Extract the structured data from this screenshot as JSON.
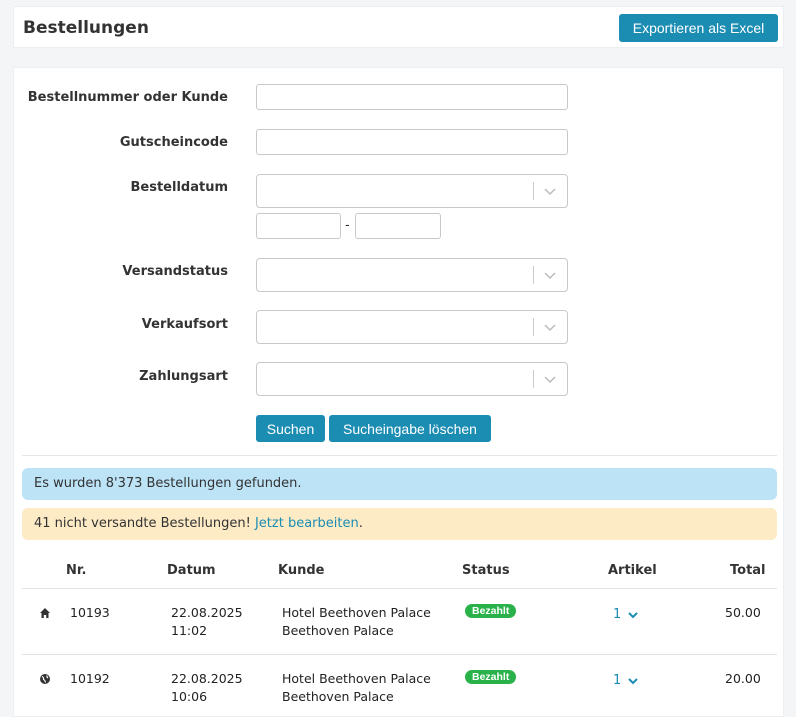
{
  "header": {
    "title": "Bestellungen",
    "export_label": "Exportieren als Excel"
  },
  "filters": {
    "order_label": "Bestellnummer oder Kunde",
    "coupon_label": "Gutscheincode",
    "date_label": "Bestelldatum",
    "date_separator": "-",
    "shipping_label": "Versandstatus",
    "salesplace_label": "Verkaufsort",
    "payment_label": "Zahlungsart",
    "search_label": "Suchen",
    "clear_label": "Sucheingabe löschen"
  },
  "alerts": {
    "found_text": "Es wurden 8'373 Bestellungen gefunden.",
    "unshipped_text": "41 nicht versandte Bestellungen! ",
    "unshipped_link": "Jetzt bearbeiten",
    "unshipped_suffix": "."
  },
  "table": {
    "headers": {
      "nr": "Nr.",
      "date": "Datum",
      "customer": "Kunde",
      "status": "Status",
      "articles": "Artikel",
      "total": "Total"
    },
    "rows": [
      {
        "icon": "home-icon",
        "nr": "10193",
        "date": "22.08.2025",
        "time": "11:02",
        "customer_line1": "Hotel Beethoven Palace",
        "customer_line2": "Beethoven Palace",
        "status": "Bezahlt",
        "articles": "1",
        "total": "50.00"
      },
      {
        "icon": "globe-icon",
        "nr": "10192",
        "date": "22.08.2025",
        "time": "10:06",
        "customer_line1": "Hotel Beethoven Palace",
        "customer_line2": "Beethoven Palace",
        "status": "Bezahlt",
        "articles": "1",
        "total": "20.00"
      }
    ]
  },
  "colors": {
    "accent": "#1b8cb2",
    "status_paid": "#29b24a",
    "info_bg": "#bde3f7",
    "warn_bg": "#fdebc6"
  }
}
